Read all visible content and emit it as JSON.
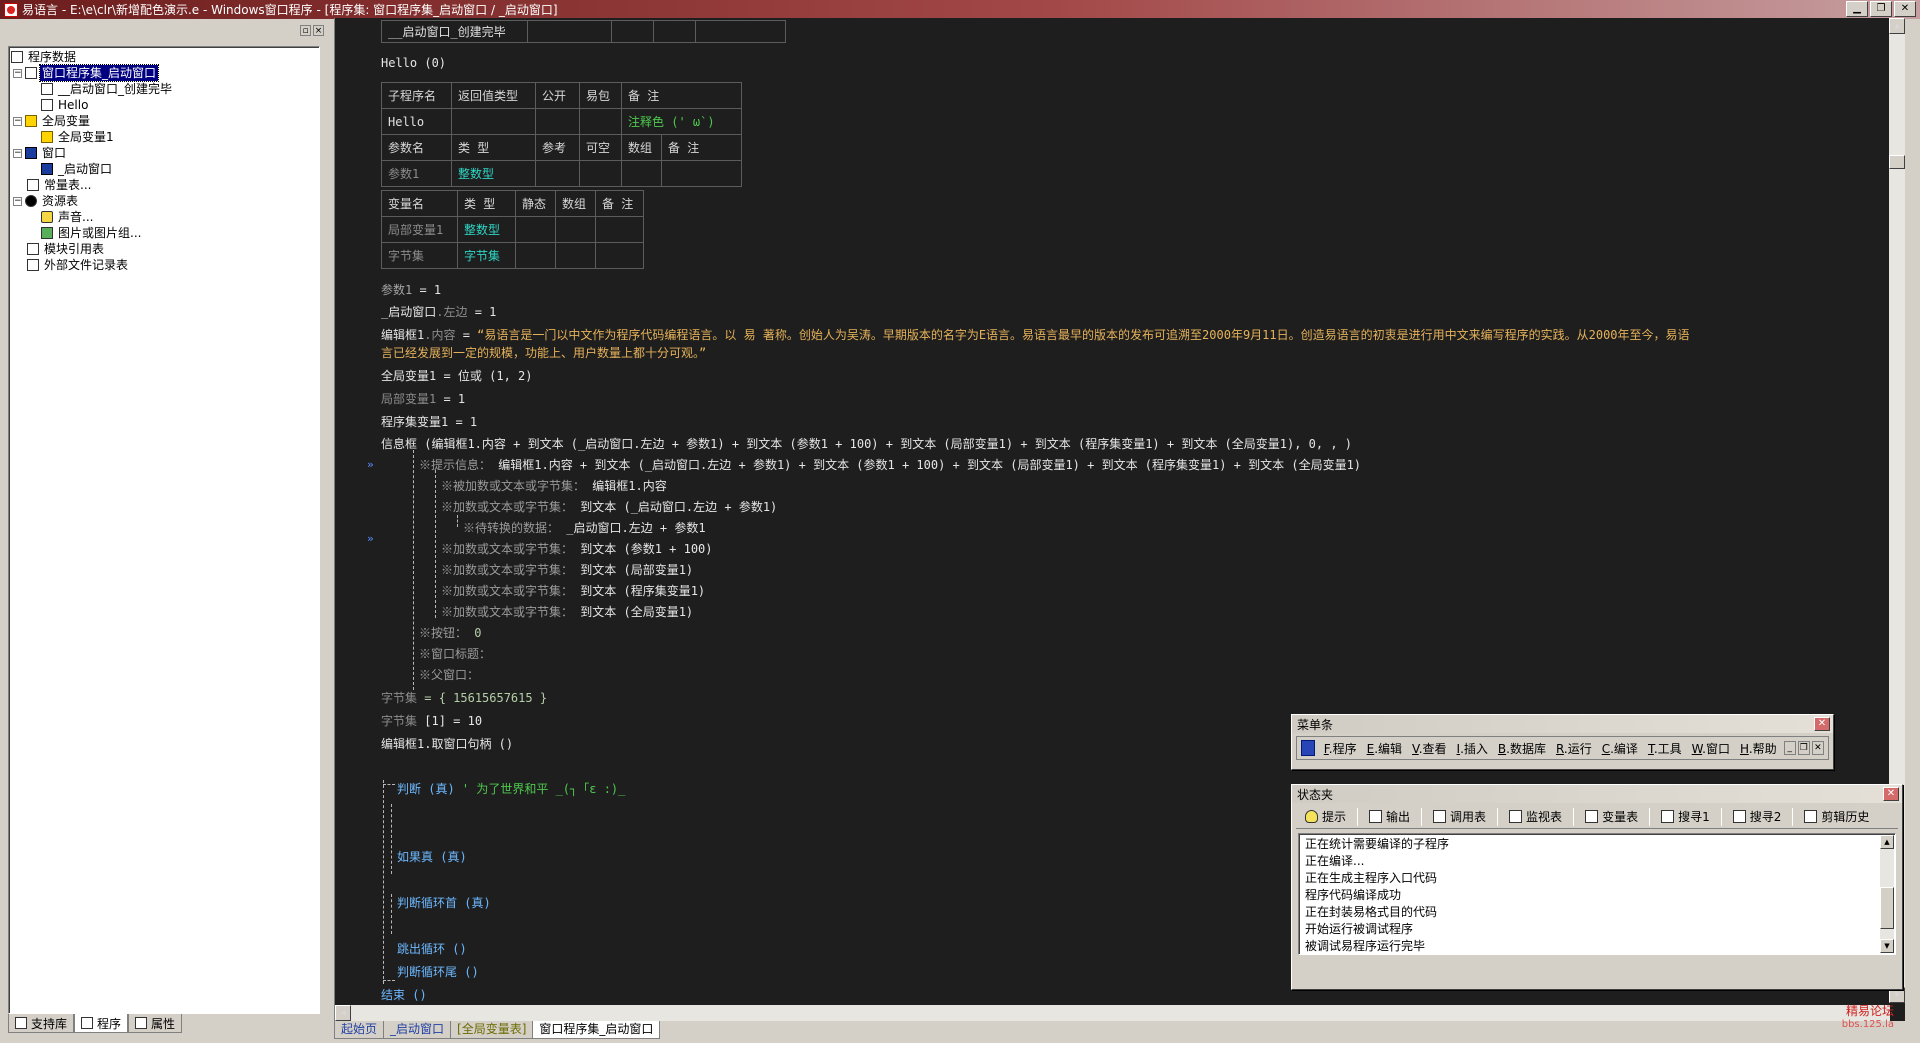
{
  "window": {
    "title": "易语言 - E:\\e\\clr\\新增配色演示.e - Windows窗口程序 - [程序集: 窗口程序集_启动窗口 / _启动窗口]",
    "minimize": "0",
    "restore": "1",
    "close": "r"
  },
  "tree": {
    "root": "程序数据",
    "nodes": [
      {
        "label": "窗口程序集_启动窗口",
        "selected": true
      },
      {
        "label": "__启动窗口_创建完毕"
      },
      {
        "label": "Hello"
      },
      {
        "label": "全局变量"
      },
      {
        "label": "全局变量1"
      },
      {
        "label": "窗口"
      },
      {
        "label": "_启动窗口"
      },
      {
        "label": "常量表..."
      },
      {
        "label": "资源表"
      },
      {
        "label": "声音..."
      },
      {
        "label": "图片或图片组..."
      },
      {
        "label": "模块引用表"
      },
      {
        "label": "外部文件记录表"
      }
    ]
  },
  "left_tabs": {
    "support": "支持库",
    "program": "程序",
    "property": "属性"
  },
  "code": {
    "top_sub": "__启动窗口_创建完毕",
    "hello_call": "Hello (0)",
    "sub_table": {
      "headers": [
        "子程序名",
        "返回值类型",
        "公开",
        "易包",
        "备 注"
      ],
      "name": "Hello",
      "comment": "注释色 (' ω`)",
      "param_headers": [
        "参数名",
        "类 型",
        "参考",
        "可空",
        "数组",
        "备 注"
      ],
      "param_name": "参数1",
      "param_type": "整数型"
    },
    "var_table": {
      "headers": [
        "变量名",
        "类 型",
        "静态",
        "数组",
        "备 注"
      ],
      "rows": [
        {
          "name": "局部变量1",
          "type": "整数型"
        },
        {
          "name": "字节集",
          "type": "字节集"
        }
      ]
    },
    "lines": {
      "l1a": "参数1",
      "l1b": " = 1",
      "l2a": "_启动窗口",
      "l2b": ".左边",
      "l2c": " = 1",
      "l3a": "编辑框1",
      "l3b": ".内容",
      "l3c": " = ",
      "l3d": "“易语言是一门以中文作为程序代码编程语言。以 易 著称。创始人为吴涛。早期版本的名字为E语言。易语言最早的版本的发布可追溯至2000年9月11日。创造易语言的初衷是进行用中文来编写程序的实践。从2000年至今，易语",
      "l3e": "言已经发展到一定的规模，功能上、用户数量上都十分可观。”",
      "l4a": "全局变量1",
      "l4b": " = 位或 (1, 2)",
      "l5a": "局部变量1",
      "l5b": " = 1",
      "l6a": "程序集变量1",
      "l6b": " = 1",
      "l7": "信息框 (编辑框1.内容 + 到文本 (_启动窗口.左边 + 参数1) + 到文本 (参数1 + 100) + 到文本 (局部变量1) + 到文本 (程序集变量1) + 到文本 (全局变量1), 0, , )",
      "t1a": "※提示信息：",
      "t1b": "编辑框1.内容 + 到文本 (_启动窗口.左边 + 参数1) + 到文本 (参数1 + 100) + 到文本 (局部变量1) + 到文本 (程序集变量1) + 到文本 (全局变量1)",
      "t2a": "※被加数或文本或字节集：",
      "t2b": "编辑框1.内容",
      "t3a": "※加数或文本或字节集：",
      "t3b": "到文本 (_启动窗口.左边 + 参数1)",
      "t4a": "※待转换的数据：",
      "t4b": "_启动窗口.左边 + 参数1",
      "t5a": "※加数或文本或字节集：",
      "t5b": "到文本 (参数1 + 100)",
      "t6a": "※加数或文本或字节集：",
      "t6b": "到文本 (局部变量1)",
      "t7a": "※加数或文本或字节集：",
      "t7b": "到文本 (程序集变量1)",
      "t8a": "※加数或文本或字节集：",
      "t8b": "到文本 (全局变量1)",
      "t9a": "※按钮：",
      "t9b": "0",
      "t10": "※窗口标题：",
      "t11": "※父窗口：",
      "l8a": "字节集",
      "l8b": " = { 15615657615 }",
      "l9a": "字节集",
      "l9b": " [1] = 10",
      "l10": "编辑框1.取窗口句柄 ()",
      "l11a": "判断 (真)",
      "l11b": "  ' 为了世界和平 _(┐「ε :)_",
      "l12": "如果真 (真)",
      "l13": "判断循环首 (真)",
      "l14": "跳出循环 ()",
      "l15": "判断循环尾 ()",
      "l16": "结束 ()"
    },
    "gutter_marks": [
      "»",
      "»"
    ]
  },
  "bottom_tabs": [
    "起始页",
    "_启动窗口",
    "[全局变量表]",
    "窗口程序集_启动窗口"
  ],
  "menu_window": {
    "title": "菜单条",
    "items": [
      {
        "key": "F",
        "label": ".程序"
      },
      {
        "key": "E",
        "label": ".编辑"
      },
      {
        "key": "V",
        "label": ".查看"
      },
      {
        "key": "I",
        "label": ".插入"
      },
      {
        "key": "B",
        "label": ".数据库"
      },
      {
        "key": "R",
        "label": ".运行"
      },
      {
        "key": "C",
        "label": ".编译"
      },
      {
        "key": "T",
        "label": ".工具"
      },
      {
        "key": "W",
        "label": ".窗口"
      },
      {
        "key": "H",
        "label": ".帮助"
      }
    ]
  },
  "status_window": {
    "title": "状态夹",
    "tools": [
      "提示",
      "输出",
      "调用表",
      "监视表",
      "变量表",
      "搜寻1",
      "搜寻2",
      "剪辑历史"
    ],
    "output": [
      "正在统计需要编译的子程序",
      "正在编译...",
      "正在生成主程序入口代码",
      "程序代码编译成功",
      "正在封装易格式目的代码",
      "开始运行被调试程序",
      "被调试易程序运行完毕"
    ]
  },
  "watermark": {
    "line1": "精易论坛",
    "line2": "bbs.125.la"
  }
}
